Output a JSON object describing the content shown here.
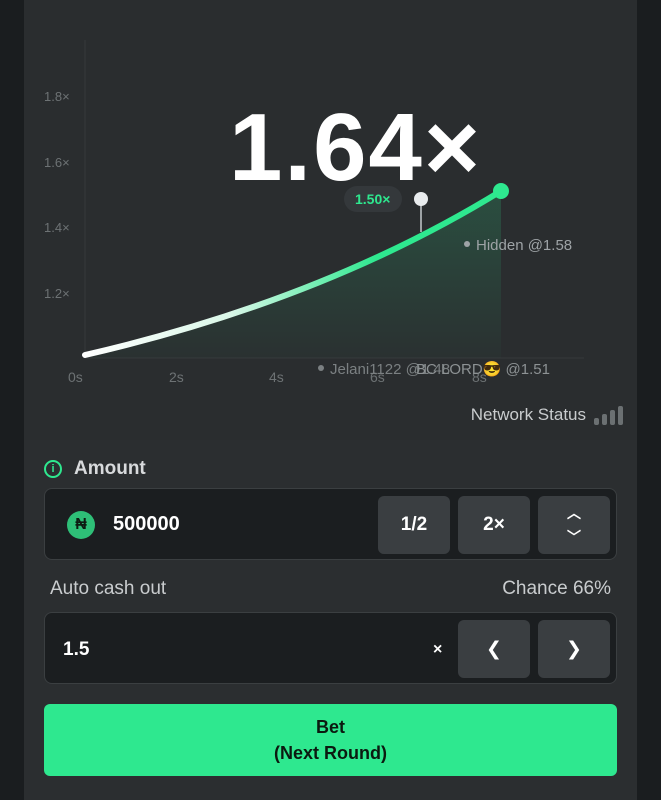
{
  "game": {
    "multiplier": "1.64×",
    "axis": {
      "y_ticks": [
        "1.2×",
        "1.4×",
        "1.6×",
        "1.8×"
      ],
      "x_ticks": [
        "0s",
        "2s",
        "4s",
        "6s",
        "8s"
      ]
    },
    "cashout_marker": "1.50×",
    "players": [
      {
        "label": "Hidden @1.58"
      },
      {
        "label": "Jelani1122 @1.48"
      },
      {
        "label": "BC LORD😎 @1.51"
      }
    ],
    "network_status_label": "Network Status"
  },
  "controls": {
    "amount_label": "Amount",
    "currency_symbol": "₦",
    "amount_value": "500000",
    "half_label": "1/2",
    "double_label": "2×",
    "auto_cashout_label": "Auto cash out",
    "chance_label": "Chance 66%",
    "auto_cashout_value": "1.5",
    "auto_cashout_unit": "×",
    "bet_label_line1": "Bet",
    "bet_label_line2": "(Next Round)"
  },
  "colors": {
    "accent": "#2ee88f",
    "panel": "#2a2d2f",
    "input_bg": "#1b1e20"
  },
  "icons": [
    "info-icon",
    "naira-icon",
    "chevron-up-icon",
    "chevron-down-icon",
    "chevron-left-icon",
    "chevron-right-icon",
    "signal-bars-icon"
  ]
}
